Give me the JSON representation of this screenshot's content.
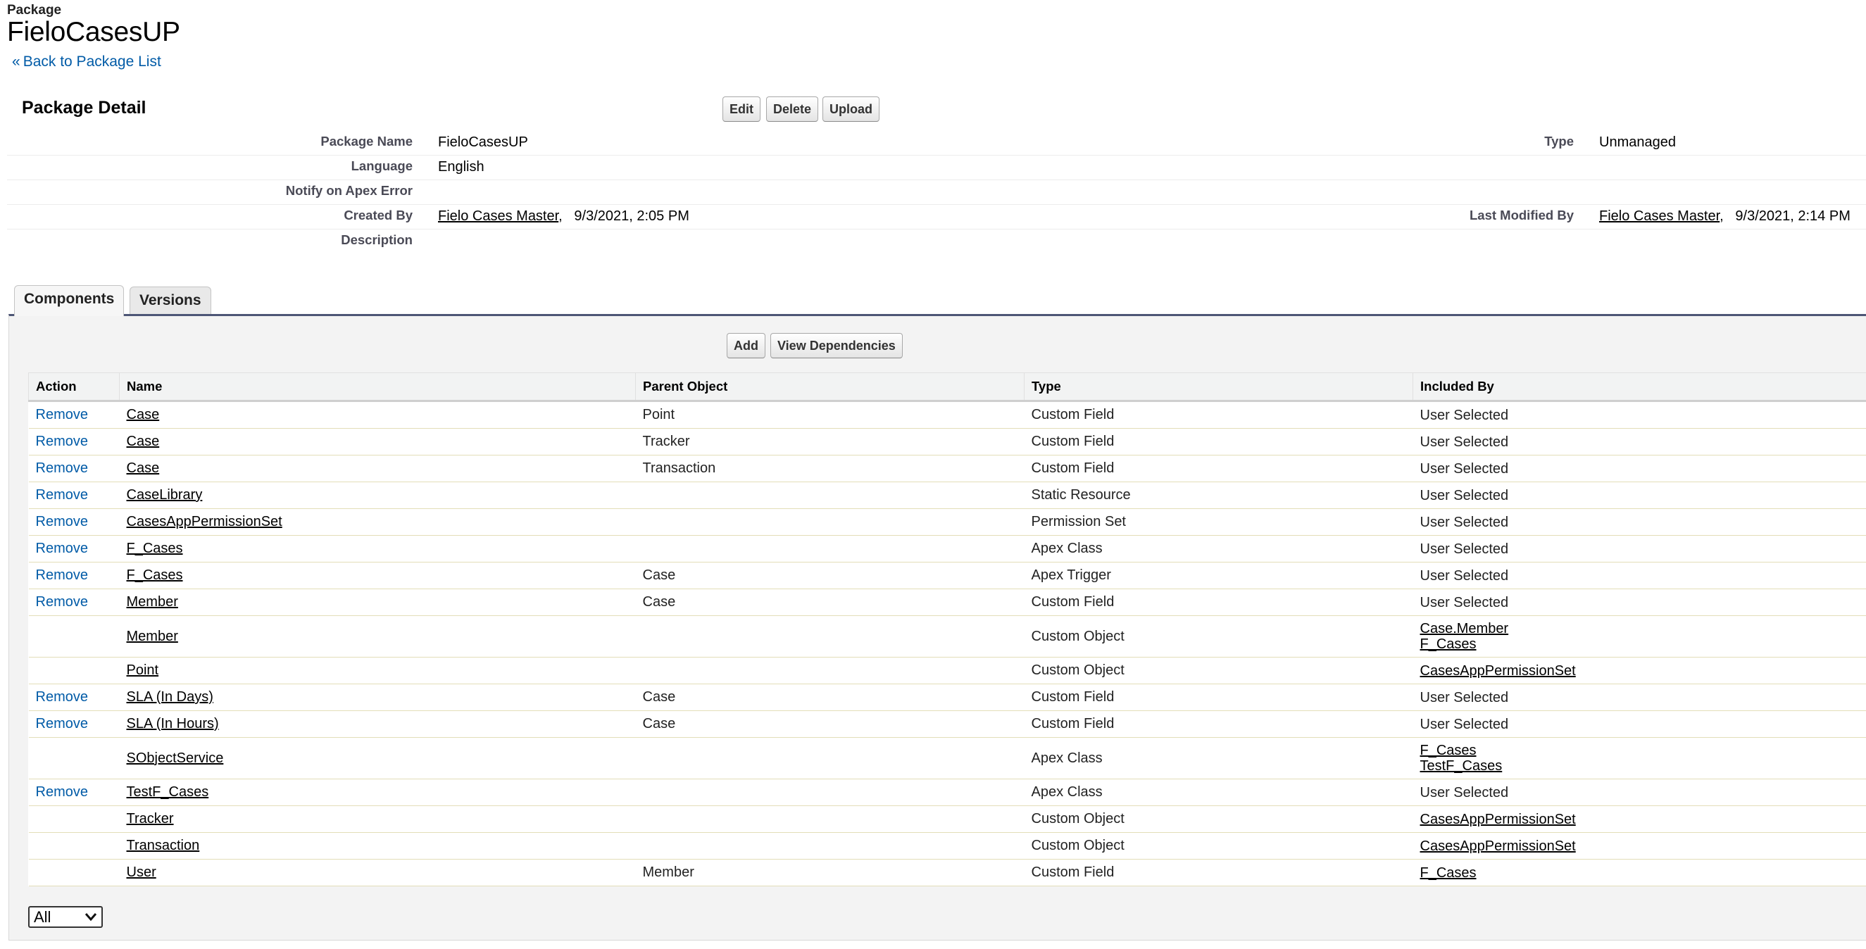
{
  "header": {
    "entity_type": "Package",
    "title": "FieloCasesUP",
    "back_link": "Back to Package List"
  },
  "detail": {
    "section_title": "Package Detail",
    "buttons": {
      "edit": "Edit",
      "delete": "Delete",
      "upload": "Upload"
    },
    "fields": {
      "package_name_label": "Package Name",
      "package_name": "FieloCasesUP",
      "type_label": "Type",
      "type": "Unmanaged",
      "language_label": "Language",
      "language": "English",
      "notify_label": "Notify on Apex Error",
      "created_by_label": "Created By",
      "created_by_user": "Fielo Cases Master",
      "created_by_date": "9/3/2021, 2:05 PM",
      "last_modified_label": "Last Modified By",
      "last_modified_user": "Fielo Cases Master",
      "last_modified_date": "9/3/2021, 2:14 PM",
      "description_label": "Description"
    }
  },
  "tabs": [
    {
      "label": "Components",
      "active": true
    },
    {
      "label": "Versions",
      "active": false
    }
  ],
  "components": {
    "buttons": {
      "add": "Add",
      "view_dependencies": "View Dependencies"
    },
    "columns": [
      "Action",
      "Name",
      "Parent Object",
      "Type",
      "Included By"
    ],
    "rows": [
      {
        "action": "Remove",
        "name": "Case",
        "parent": "Point",
        "type": "Custom Field",
        "included": [
          "User Selected"
        ]
      },
      {
        "action": "Remove",
        "name": "Case",
        "parent": "Tracker",
        "type": "Custom Field",
        "included": [
          "User Selected"
        ]
      },
      {
        "action": "Remove",
        "name": "Case",
        "parent": "Transaction",
        "type": "Custom Field",
        "included": [
          "User Selected"
        ]
      },
      {
        "action": "Remove",
        "name": "CaseLibrary",
        "parent": "",
        "type": "Static Resource",
        "included": [
          "User Selected"
        ]
      },
      {
        "action": "Remove",
        "name": "CasesAppPermissionSet",
        "parent": "",
        "type": "Permission Set",
        "included": [
          "User Selected"
        ]
      },
      {
        "action": "Remove",
        "name": "F_Cases",
        "parent": "",
        "type": "Apex Class",
        "included": [
          "User Selected"
        ]
      },
      {
        "action": "Remove",
        "name": "F_Cases",
        "parent": "Case",
        "type": "Apex Trigger",
        "included": [
          "User Selected"
        ]
      },
      {
        "action": "Remove",
        "name": "Member",
        "parent": "Case",
        "type": "Custom Field",
        "included": [
          "User Selected"
        ]
      },
      {
        "action": "",
        "name": "Member",
        "parent": "",
        "type": "Custom Object",
        "included": [
          "Case.Member",
          "F_Cases"
        ],
        "included_links": true
      },
      {
        "action": "",
        "name": "Point",
        "parent": "",
        "type": "Custom Object",
        "included": [
          "CasesAppPermissionSet"
        ],
        "included_links": true
      },
      {
        "action": "Remove",
        "name": "SLA (In Days)",
        "parent": "Case",
        "type": "Custom Field",
        "included": [
          "User Selected"
        ]
      },
      {
        "action": "Remove",
        "name": "SLA (In Hours)",
        "parent": "Case",
        "type": "Custom Field",
        "included": [
          "User Selected"
        ]
      },
      {
        "action": "",
        "name": "SObjectService",
        "parent": "",
        "type": "Apex Class",
        "included": [
          "F_Cases",
          "TestF_Cases"
        ],
        "included_links": true
      },
      {
        "action": "Remove",
        "name": "TestF_Cases",
        "parent": "",
        "type": "Apex Class",
        "included": [
          "User Selected"
        ]
      },
      {
        "action": "",
        "name": "Tracker",
        "parent": "",
        "type": "Custom Object",
        "included": [
          "CasesAppPermissionSet"
        ],
        "included_links": true
      },
      {
        "action": "",
        "name": "Transaction",
        "parent": "",
        "type": "Custom Object",
        "included": [
          "CasesAppPermissionSet"
        ],
        "included_links": true
      },
      {
        "action": "",
        "name": "User",
        "parent": "Member",
        "type": "Custom Field",
        "included": [
          "F_Cases"
        ],
        "included_links": true
      }
    ],
    "filter": {
      "selected": "All"
    }
  },
  "icons": {
    "back": "double-chevron-left-icon",
    "dropdown": "chevron-down-icon"
  }
}
